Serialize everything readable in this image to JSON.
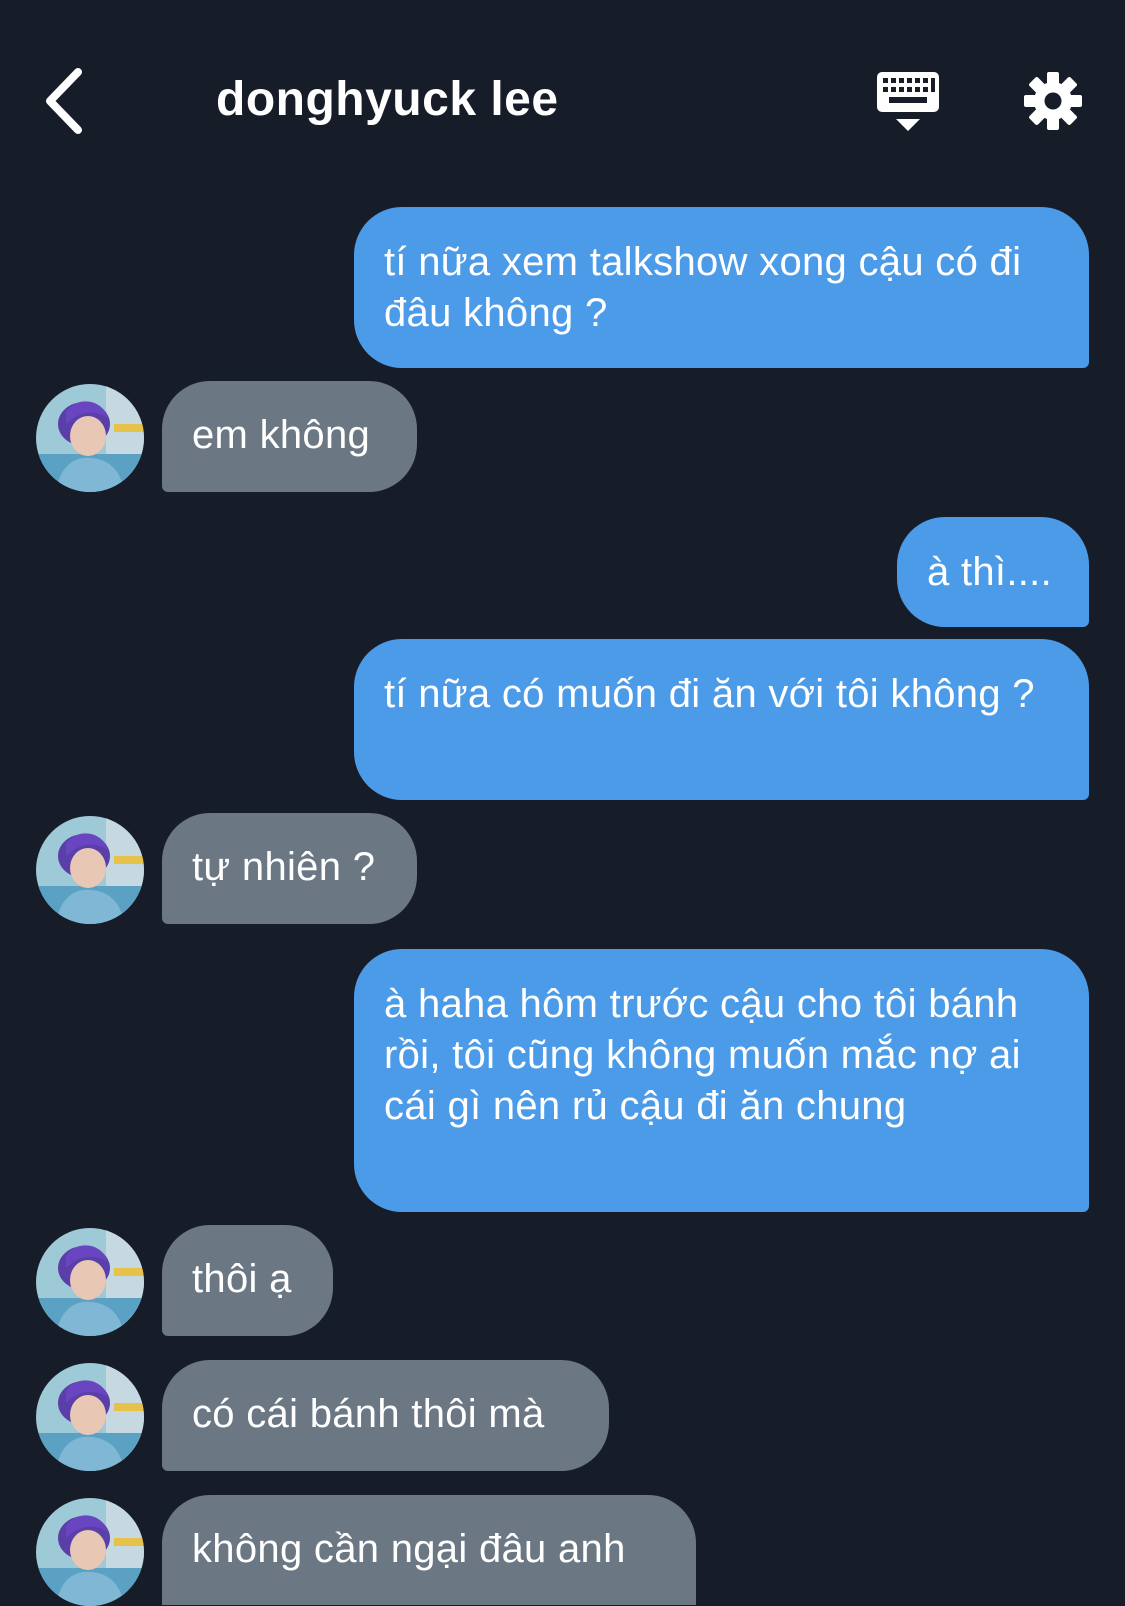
{
  "header": {
    "title": "donghyuck lee",
    "back_icon": "chevron-left-icon",
    "keyboard_icon": "keyboard-icon",
    "settings_icon": "gear-icon"
  },
  "colors": {
    "background": "#161d28",
    "sent_bubble": "#4c9be8",
    "received_bubble": "#6c7784",
    "text": "#ffffff"
  },
  "messages": [
    {
      "from": "me",
      "text": "tí nữa xem talkshow xong cậu có đi đâu không ?"
    },
    {
      "from": "them",
      "text": "em không"
    },
    {
      "from": "me",
      "text": "à thì...."
    },
    {
      "from": "me",
      "text": "tí nữa có muốn đi ăn với tôi không ?"
    },
    {
      "from": "them",
      "text": "tự nhiên ?"
    },
    {
      "from": "me",
      "text": "à haha hôm trước cậu cho tôi bánh rồi, tôi cũng không muốn mắc nợ ai cái gì nên rủ cậu đi ăn chung"
    },
    {
      "from": "them",
      "text": "thôi ạ"
    },
    {
      "from": "them",
      "text": "có cái bánh thôi mà"
    },
    {
      "from": "them",
      "text": "không cần ngại đâu anh"
    }
  ]
}
